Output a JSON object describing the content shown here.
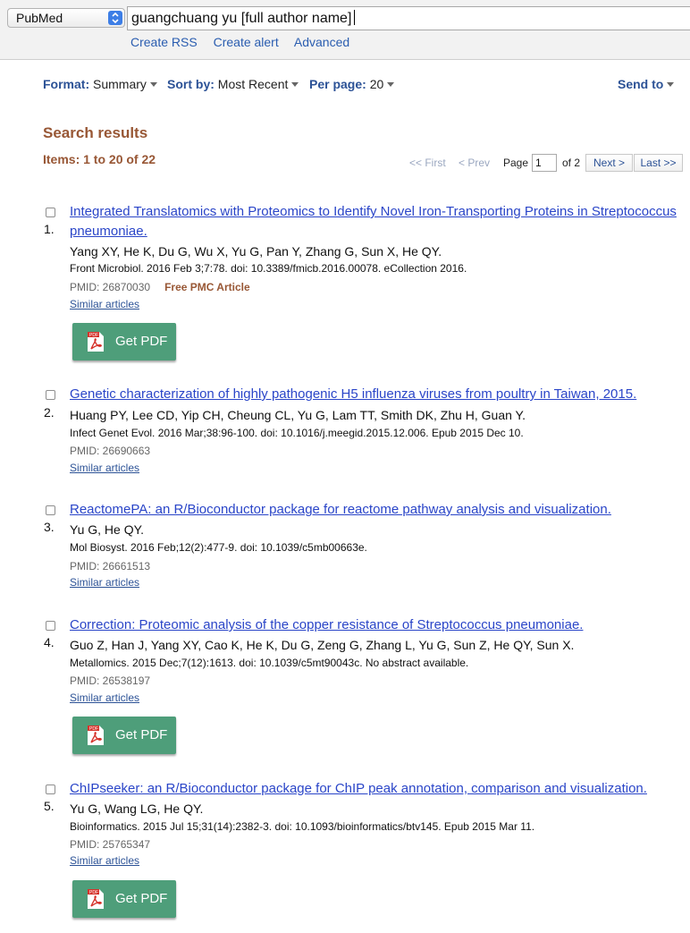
{
  "search": {
    "database": "PubMed",
    "query": "guangchuang yu [full author name]",
    "links": [
      "Create RSS",
      "Create alert",
      "Advanced"
    ]
  },
  "display": {
    "format_label": "Format:",
    "format_value": "Summary",
    "sort_label": "Sort by:",
    "sort_value": "Most Recent",
    "perpage_label": "Per page:",
    "perpage_value": "20",
    "send_to": "Send to"
  },
  "results_header": {
    "title": "Search results",
    "items": "Items: 1 to 20 of 22"
  },
  "pager": {
    "first": "<< First",
    "prev": "< Prev",
    "page_label": "Page",
    "page_value": "1",
    "of_label": "of 2",
    "next": "Next >",
    "last": "Last >>"
  },
  "results": [
    {
      "num": "1.",
      "title": "Integrated Translatomics with Proteomics to Identify Novel Iron-Transporting Proteins in Streptococcus pneumoniae.",
      "authors": "Yang XY, He K, Du G, Wu X, Yu G, Pan Y, Zhang G, Sun X, He QY.",
      "journal": "Front Microbiol. 2016 Feb 3;7:78. doi: 10.3389/fmicb.2016.00078. eCollection 2016.",
      "pmid": "PMID: 26870030",
      "free": "Free PMC Article",
      "similar": "Similar articles",
      "pdf": "Get PDF"
    },
    {
      "num": "2.",
      "title": "Genetic characterization of highly pathogenic H5 influenza viruses from poultry in Taiwan, 2015.",
      "authors": "Huang PY, Lee CD, Yip CH, Cheung CL, Yu G, Lam TT, Smith DK, Zhu H, Guan Y.",
      "journal": "Infect Genet Evol. 2016 Mar;38:96-100. doi: 10.1016/j.meegid.2015.12.006. Epub 2015 Dec 10.",
      "pmid": "PMID: 26690663",
      "similar": "Similar articles"
    },
    {
      "num": "3.",
      "title": "ReactomePA: an R/Bioconductor package for reactome pathway analysis and visualization.",
      "authors": "Yu G, He QY.",
      "journal": "Mol Biosyst. 2016 Feb;12(2):477-9. doi: 10.1039/c5mb00663e.",
      "pmid": "PMID: 26661513",
      "similar": "Similar articles"
    },
    {
      "num": "4.",
      "title": "Correction: Proteomic analysis of the copper resistance of Streptococcus pneumoniae.",
      "authors": "Guo Z, Han J, Yang XY, Cao K, He K, Du G, Zeng G, Zhang L, Yu G, Sun Z, He QY, Sun X.",
      "journal": "Metallomics. 2015 Dec;7(12):1613. doi: 10.1039/c5mt90043c. No abstract available.",
      "pmid": "PMID: 26538197",
      "similar": "Similar articles",
      "pdf": "Get PDF"
    },
    {
      "num": "5.",
      "title": "ChIPseeker: an R/Bioconductor package for ChIP peak annotation, comparison and visualization.",
      "authors": "Yu G, Wang LG, He QY.",
      "journal": "Bioinformatics. 2015 Jul 15;31(14):2382-3. doi: 10.1093/bioinformatics/btv145. Epub 2015 Mar 11.",
      "pmid": "PMID: 25765347",
      "similar": "Similar articles",
      "pdf": "Get PDF"
    }
  ],
  "colors": {
    "link": "#2a45c8",
    "heading": "#985735",
    "pdf_button": "#4e9e7a"
  },
  "icons": [
    "up-down-arrows-icon",
    "pdf-file-icon",
    "dropdown-triangle-icon"
  ]
}
